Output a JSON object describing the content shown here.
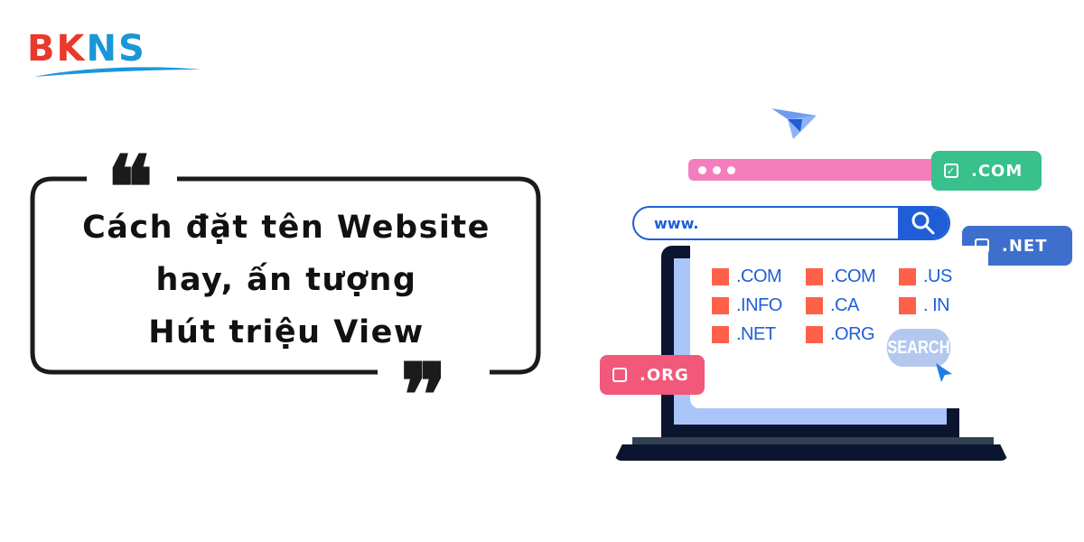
{
  "logo": {
    "part1": "BK",
    "part2": "NS",
    "colors": {
      "bk": "#e8392c",
      "ns": "#1a96d9"
    }
  },
  "headline": {
    "lines": [
      "Cách đặt tên Website",
      "hay, ấn tượng",
      "Hút triệu View"
    ],
    "open_quote": "❝",
    "close_quote": "❞"
  },
  "illustration": {
    "url_prefix": "www.",
    "tags": [
      {
        "label": ".COM",
        "checked": true,
        "color": "#38c08d"
      },
      {
        "label": ".NET",
        "checked": false,
        "color": "#3f6fcc"
      },
      {
        "label": ".ORG",
        "checked": false,
        "color": "#f2587a"
      }
    ],
    "check_glyph": "✓",
    "domains": [
      [
        ".COM",
        ".COM",
        ".US"
      ],
      [
        ".INFO",
        ".CA",
        ". IN"
      ],
      [
        ".NET",
        ".ORG"
      ]
    ],
    "search_button": "SEARCH",
    "icons": [
      "paper-plane-icon",
      "search-icon",
      "cursor-icon",
      "checkbox-icon"
    ]
  }
}
